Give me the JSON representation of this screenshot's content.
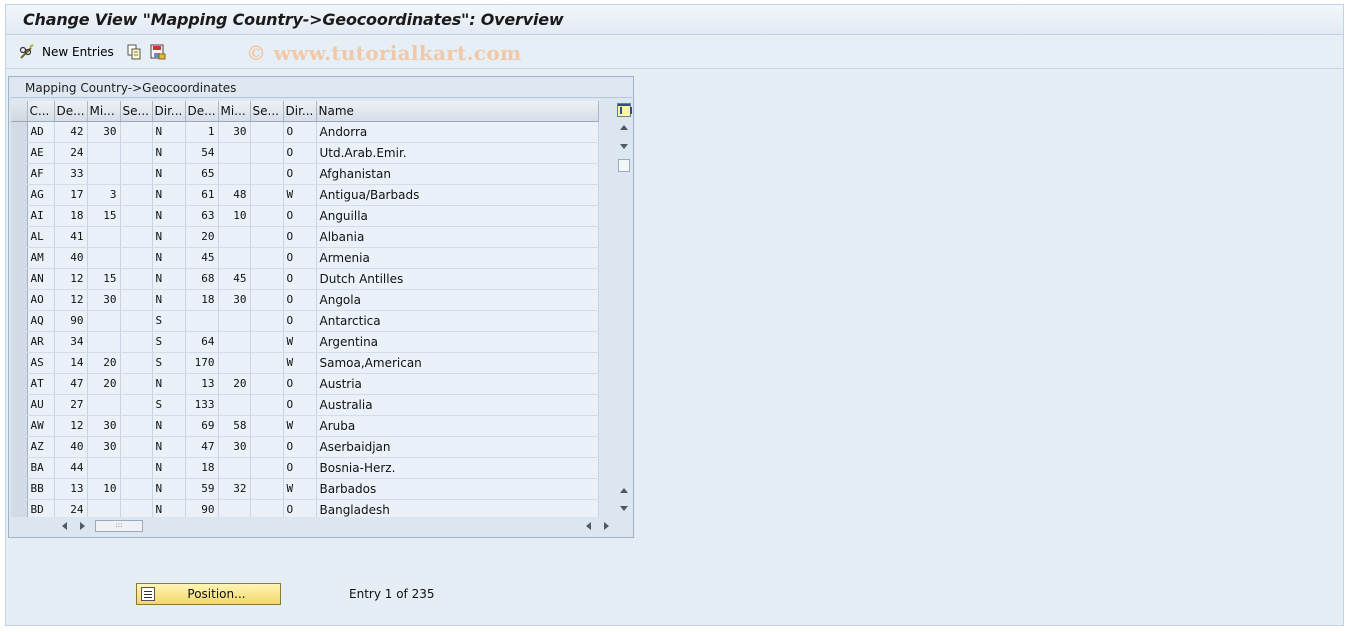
{
  "window": {
    "title": "Change View \"Mapping Country->Geocoordinates\": Overview"
  },
  "toolbar": {
    "new_entries_label": "New Entries",
    "watermark": "© www.tutorialkart.com",
    "icons": [
      "pencil-glasses-icon",
      "copy-icon",
      "save-export-icon"
    ]
  },
  "panel": {
    "title": "Mapping Country->Geocoordinates"
  },
  "table": {
    "headers": [
      "C...",
      "De...",
      "Mi...",
      "Se...",
      "Dir...",
      "De...",
      "Mi...",
      "Se...",
      "Dir...",
      "Name"
    ],
    "rows": [
      [
        "AD",
        "42",
        "30",
        "",
        "N",
        "1",
        "30",
        "",
        "O",
        "Andorra"
      ],
      [
        "AE",
        "24",
        "",
        "",
        "N",
        "54",
        "",
        "",
        "O",
        "Utd.Arab.Emir."
      ],
      [
        "AF",
        "33",
        "",
        "",
        "N",
        "65",
        "",
        "",
        "O",
        "Afghanistan"
      ],
      [
        "AG",
        "17",
        "3",
        "",
        "N",
        "61",
        "48",
        "",
        "W",
        "Antigua/Barbads"
      ],
      [
        "AI",
        "18",
        "15",
        "",
        "N",
        "63",
        "10",
        "",
        "O",
        "Anguilla"
      ],
      [
        "AL",
        "41",
        "",
        "",
        "N",
        "20",
        "",
        "",
        "O",
        "Albania"
      ],
      [
        "AM",
        "40",
        "",
        "",
        "N",
        "45",
        "",
        "",
        "O",
        "Armenia"
      ],
      [
        "AN",
        "12",
        "15",
        "",
        "N",
        "68",
        "45",
        "",
        "O",
        "Dutch Antilles"
      ],
      [
        "AO",
        "12",
        "30",
        "",
        "N",
        "18",
        "30",
        "",
        "O",
        "Angola"
      ],
      [
        "AQ",
        "90",
        "",
        "",
        "S",
        "",
        "",
        "",
        "O",
        "Antarctica"
      ],
      [
        "AR",
        "34",
        "",
        "",
        "S",
        "64",
        "",
        "",
        "W",
        "Argentina"
      ],
      [
        "AS",
        "14",
        "20",
        "",
        "S",
        "170",
        "",
        "",
        "W",
        "Samoa,American"
      ],
      [
        "AT",
        "47",
        "20",
        "",
        "N",
        "13",
        "20",
        "",
        "O",
        "Austria"
      ],
      [
        "AU",
        "27",
        "",
        "",
        "S",
        "133",
        "",
        "",
        "O",
        "Australia"
      ],
      [
        "AW",
        "12",
        "30",
        "",
        "N",
        "69",
        "58",
        "",
        "W",
        "Aruba"
      ],
      [
        "AZ",
        "40",
        "30",
        "",
        "N",
        "47",
        "30",
        "",
        "O",
        "Aserbaidjan"
      ],
      [
        "BA",
        "44",
        "",
        "",
        "N",
        "18",
        "",
        "",
        "O",
        "Bosnia-Herz."
      ],
      [
        "BB",
        "13",
        "10",
        "",
        "N",
        "59",
        "32",
        "",
        "W",
        "Barbados"
      ],
      [
        "BD",
        "24",
        "",
        "",
        "N",
        "90",
        "",
        "",
        "O",
        "Bangladesh"
      ]
    ]
  },
  "footer": {
    "position_button_label": "Position...",
    "entry_info": "Entry 1 of 235"
  }
}
